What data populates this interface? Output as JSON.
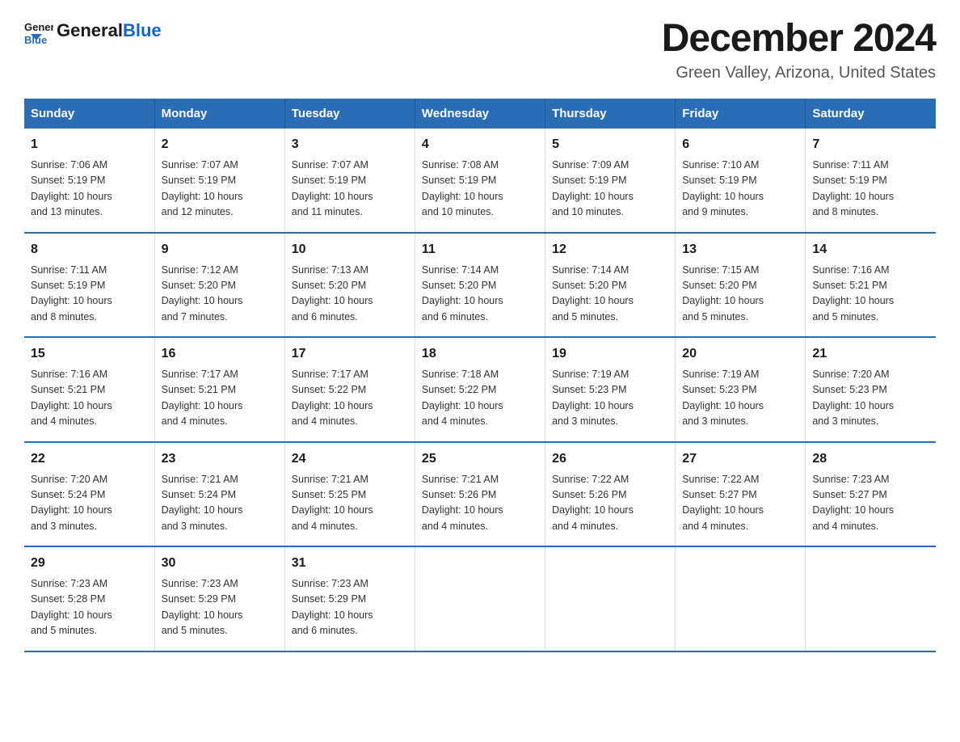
{
  "logo": {
    "general": "General",
    "blue": "Blue"
  },
  "header": {
    "title": "December 2024",
    "location": "Green Valley, Arizona, United States"
  },
  "days_of_week": [
    "Sunday",
    "Monday",
    "Tuesday",
    "Wednesday",
    "Thursday",
    "Friday",
    "Saturday"
  ],
  "weeks": [
    [
      {
        "day": "1",
        "sunrise": "7:06 AM",
        "sunset": "5:19 PM",
        "daylight": "10 hours and 13 minutes."
      },
      {
        "day": "2",
        "sunrise": "7:07 AM",
        "sunset": "5:19 PM",
        "daylight": "10 hours and 12 minutes."
      },
      {
        "day": "3",
        "sunrise": "7:07 AM",
        "sunset": "5:19 PM",
        "daylight": "10 hours and 11 minutes."
      },
      {
        "day": "4",
        "sunrise": "7:08 AM",
        "sunset": "5:19 PM",
        "daylight": "10 hours and 10 minutes."
      },
      {
        "day": "5",
        "sunrise": "7:09 AM",
        "sunset": "5:19 PM",
        "daylight": "10 hours and 10 minutes."
      },
      {
        "day": "6",
        "sunrise": "7:10 AM",
        "sunset": "5:19 PM",
        "daylight": "10 hours and 9 minutes."
      },
      {
        "day": "7",
        "sunrise": "7:11 AM",
        "sunset": "5:19 PM",
        "daylight": "10 hours and 8 minutes."
      }
    ],
    [
      {
        "day": "8",
        "sunrise": "7:11 AM",
        "sunset": "5:19 PM",
        "daylight": "10 hours and 8 minutes."
      },
      {
        "day": "9",
        "sunrise": "7:12 AM",
        "sunset": "5:20 PM",
        "daylight": "10 hours and 7 minutes."
      },
      {
        "day": "10",
        "sunrise": "7:13 AM",
        "sunset": "5:20 PM",
        "daylight": "10 hours and 6 minutes."
      },
      {
        "day": "11",
        "sunrise": "7:14 AM",
        "sunset": "5:20 PM",
        "daylight": "10 hours and 6 minutes."
      },
      {
        "day": "12",
        "sunrise": "7:14 AM",
        "sunset": "5:20 PM",
        "daylight": "10 hours and 5 minutes."
      },
      {
        "day": "13",
        "sunrise": "7:15 AM",
        "sunset": "5:20 PM",
        "daylight": "10 hours and 5 minutes."
      },
      {
        "day": "14",
        "sunrise": "7:16 AM",
        "sunset": "5:21 PM",
        "daylight": "10 hours and 5 minutes."
      }
    ],
    [
      {
        "day": "15",
        "sunrise": "7:16 AM",
        "sunset": "5:21 PM",
        "daylight": "10 hours and 4 minutes."
      },
      {
        "day": "16",
        "sunrise": "7:17 AM",
        "sunset": "5:21 PM",
        "daylight": "10 hours and 4 minutes."
      },
      {
        "day": "17",
        "sunrise": "7:17 AM",
        "sunset": "5:22 PM",
        "daylight": "10 hours and 4 minutes."
      },
      {
        "day": "18",
        "sunrise": "7:18 AM",
        "sunset": "5:22 PM",
        "daylight": "10 hours and 4 minutes."
      },
      {
        "day": "19",
        "sunrise": "7:19 AM",
        "sunset": "5:23 PM",
        "daylight": "10 hours and 3 minutes."
      },
      {
        "day": "20",
        "sunrise": "7:19 AM",
        "sunset": "5:23 PM",
        "daylight": "10 hours and 3 minutes."
      },
      {
        "day": "21",
        "sunrise": "7:20 AM",
        "sunset": "5:23 PM",
        "daylight": "10 hours and 3 minutes."
      }
    ],
    [
      {
        "day": "22",
        "sunrise": "7:20 AM",
        "sunset": "5:24 PM",
        "daylight": "10 hours and 3 minutes."
      },
      {
        "day": "23",
        "sunrise": "7:21 AM",
        "sunset": "5:24 PM",
        "daylight": "10 hours and 3 minutes."
      },
      {
        "day": "24",
        "sunrise": "7:21 AM",
        "sunset": "5:25 PM",
        "daylight": "10 hours and 4 minutes."
      },
      {
        "day": "25",
        "sunrise": "7:21 AM",
        "sunset": "5:26 PM",
        "daylight": "10 hours and 4 minutes."
      },
      {
        "day": "26",
        "sunrise": "7:22 AM",
        "sunset": "5:26 PM",
        "daylight": "10 hours and 4 minutes."
      },
      {
        "day": "27",
        "sunrise": "7:22 AM",
        "sunset": "5:27 PM",
        "daylight": "10 hours and 4 minutes."
      },
      {
        "day": "28",
        "sunrise": "7:23 AM",
        "sunset": "5:27 PM",
        "daylight": "10 hours and 4 minutes."
      }
    ],
    [
      {
        "day": "29",
        "sunrise": "7:23 AM",
        "sunset": "5:28 PM",
        "daylight": "10 hours and 5 minutes."
      },
      {
        "day": "30",
        "sunrise": "7:23 AM",
        "sunset": "5:29 PM",
        "daylight": "10 hours and 5 minutes."
      },
      {
        "day": "31",
        "sunrise": "7:23 AM",
        "sunset": "5:29 PM",
        "daylight": "10 hours and 6 minutes."
      },
      null,
      null,
      null,
      null
    ]
  ],
  "labels": {
    "sunrise": "Sunrise:",
    "sunset": "Sunset:",
    "daylight": "Daylight:"
  }
}
